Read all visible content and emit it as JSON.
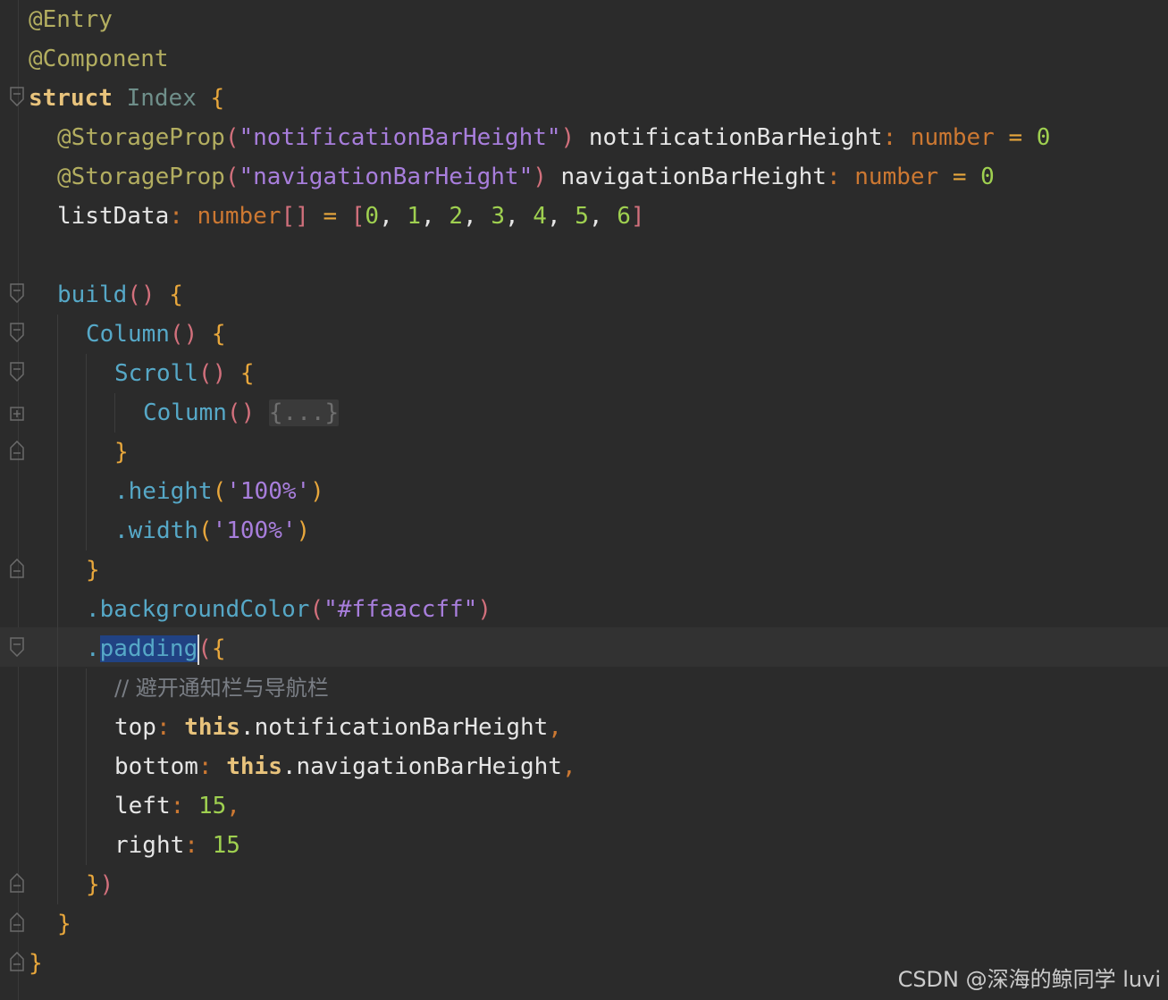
{
  "code": {
    "line1": {
      "annotation": "@Entry"
    },
    "line2": {
      "annotation": "@Component"
    },
    "line3": {
      "keyword": "struct",
      "name": "Index",
      "brace": "{"
    },
    "line4": {
      "annotation": "@StorageProp",
      "open": "(",
      "arg": "\"notificationBarHeight\"",
      "close": ")",
      "prop": " notificationBarHeight",
      "colon": ":",
      "type": "number",
      "eq": "=",
      "value": "0"
    },
    "line5": {
      "annotation": "@StorageProp",
      "open": "(",
      "arg": "\"navigationBarHeight\"",
      "close": ")",
      "prop": " navigationBarHeight",
      "colon": ":",
      "type": "number",
      "eq": "=",
      "value": "0"
    },
    "line6": {
      "prop": "listData",
      "colon": ":",
      "type": "number",
      "arr": "[]",
      "eq": "=",
      "open": "[",
      "close": "]",
      "values": [
        "0",
        "1",
        "2",
        "3",
        "4",
        "5",
        "6"
      ]
    },
    "line8": {
      "fn": "build",
      "parens": "()",
      "brace": "{"
    },
    "line9": {
      "fn": "Column",
      "parens": "()",
      "brace": "{"
    },
    "line10": {
      "fn": "Scroll",
      "parens": "()",
      "brace": "{"
    },
    "line11": {
      "fn": "Column",
      "parens": "()",
      "folded": "{...}"
    },
    "line12": {
      "brace": "}"
    },
    "line13": {
      "dot": ".",
      "method": "height",
      "open": "(",
      "arg": "'100%'",
      "close": ")"
    },
    "line14": {
      "dot": ".",
      "method": "width",
      "open": "(",
      "arg": "'100%'",
      "close": ")"
    },
    "line15": {
      "brace": "}"
    },
    "line16": {
      "dot": ".",
      "method": "backgroundColor",
      "open": "(",
      "arg": "\"#ffaaccff\"",
      "close": ")"
    },
    "line17": {
      "dot": ".",
      "method": "padding",
      "open": "(",
      "brace": "{"
    },
    "line18": {
      "comment": "// 避开通知栏与导航栏"
    },
    "line19": {
      "key": "top",
      "colon": ":",
      "this": "this",
      "dot": ".",
      "prop": "notificationBarHeight",
      "comma": ","
    },
    "line20": {
      "key": "bottom",
      "colon": ":",
      "this": "this",
      "dot": ".",
      "prop": "navigationBarHeight",
      "comma": ","
    },
    "line21": {
      "key": "left",
      "colon": ":",
      "value": "15",
      "comma": ","
    },
    "line22": {
      "key": "right",
      "colon": ":",
      "value": "15"
    },
    "line23": {
      "brace": "}",
      "close": ")"
    },
    "line24": {
      "brace": "}"
    },
    "line25": {
      "brace": "}"
    }
  },
  "watermark": "CSDN @深海的鲸同学 luvi",
  "icons": {
    "fold_expanded": "fold-open-icon",
    "fold_collapsed": "fold-closed-icon"
  },
  "colors": {
    "background": "#2b2b2b",
    "annotation": "#b3ae60",
    "keyword": "#e8c37c",
    "function": "#56a8c7",
    "string": "#a87edc",
    "number": "#9fd050",
    "type": "#cc7832",
    "comment": "#7a7e85",
    "selection": "#214283"
  }
}
